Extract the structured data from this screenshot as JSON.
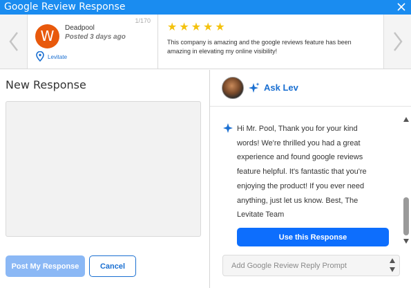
{
  "window": {
    "title": "Google Review Response",
    "close_icon": "close-icon"
  },
  "carousel": {
    "prev_icon": "chevron-left-icon",
    "next_icon": "chevron-right-icon",
    "review": {
      "avatar_letter": "W",
      "reviewer_name": "Deadpool",
      "posted": "Posted 3 days ago",
      "count": "1/170",
      "location": "Levitate",
      "rating": 5,
      "text": "This company is amazing and the google reviews feature has been amazing in elevating my online visibility!"
    }
  },
  "left": {
    "title": "New Response",
    "response_value": "",
    "post_label": "Post My Response",
    "cancel_label": "Cancel"
  },
  "right": {
    "header": "Ask Lev",
    "message": "Hi Mr. Pool, Thank you for your kind words! We're thrilled you had a great experience and found google reviews feature helpful. It's fantastic that you're enjoying the product! If you ever need anything, just let us know. Best, The Levitate Team",
    "use_label": "Use this Response",
    "prompt_placeholder": "Add Google Review Reply Prompt"
  },
  "colors": {
    "accent": "#1a8cf0",
    "button_primary": "#0d6efd",
    "button_disabled": "#8bb8f5",
    "star": "#f4c20d",
    "avatar": "#e8590c"
  }
}
